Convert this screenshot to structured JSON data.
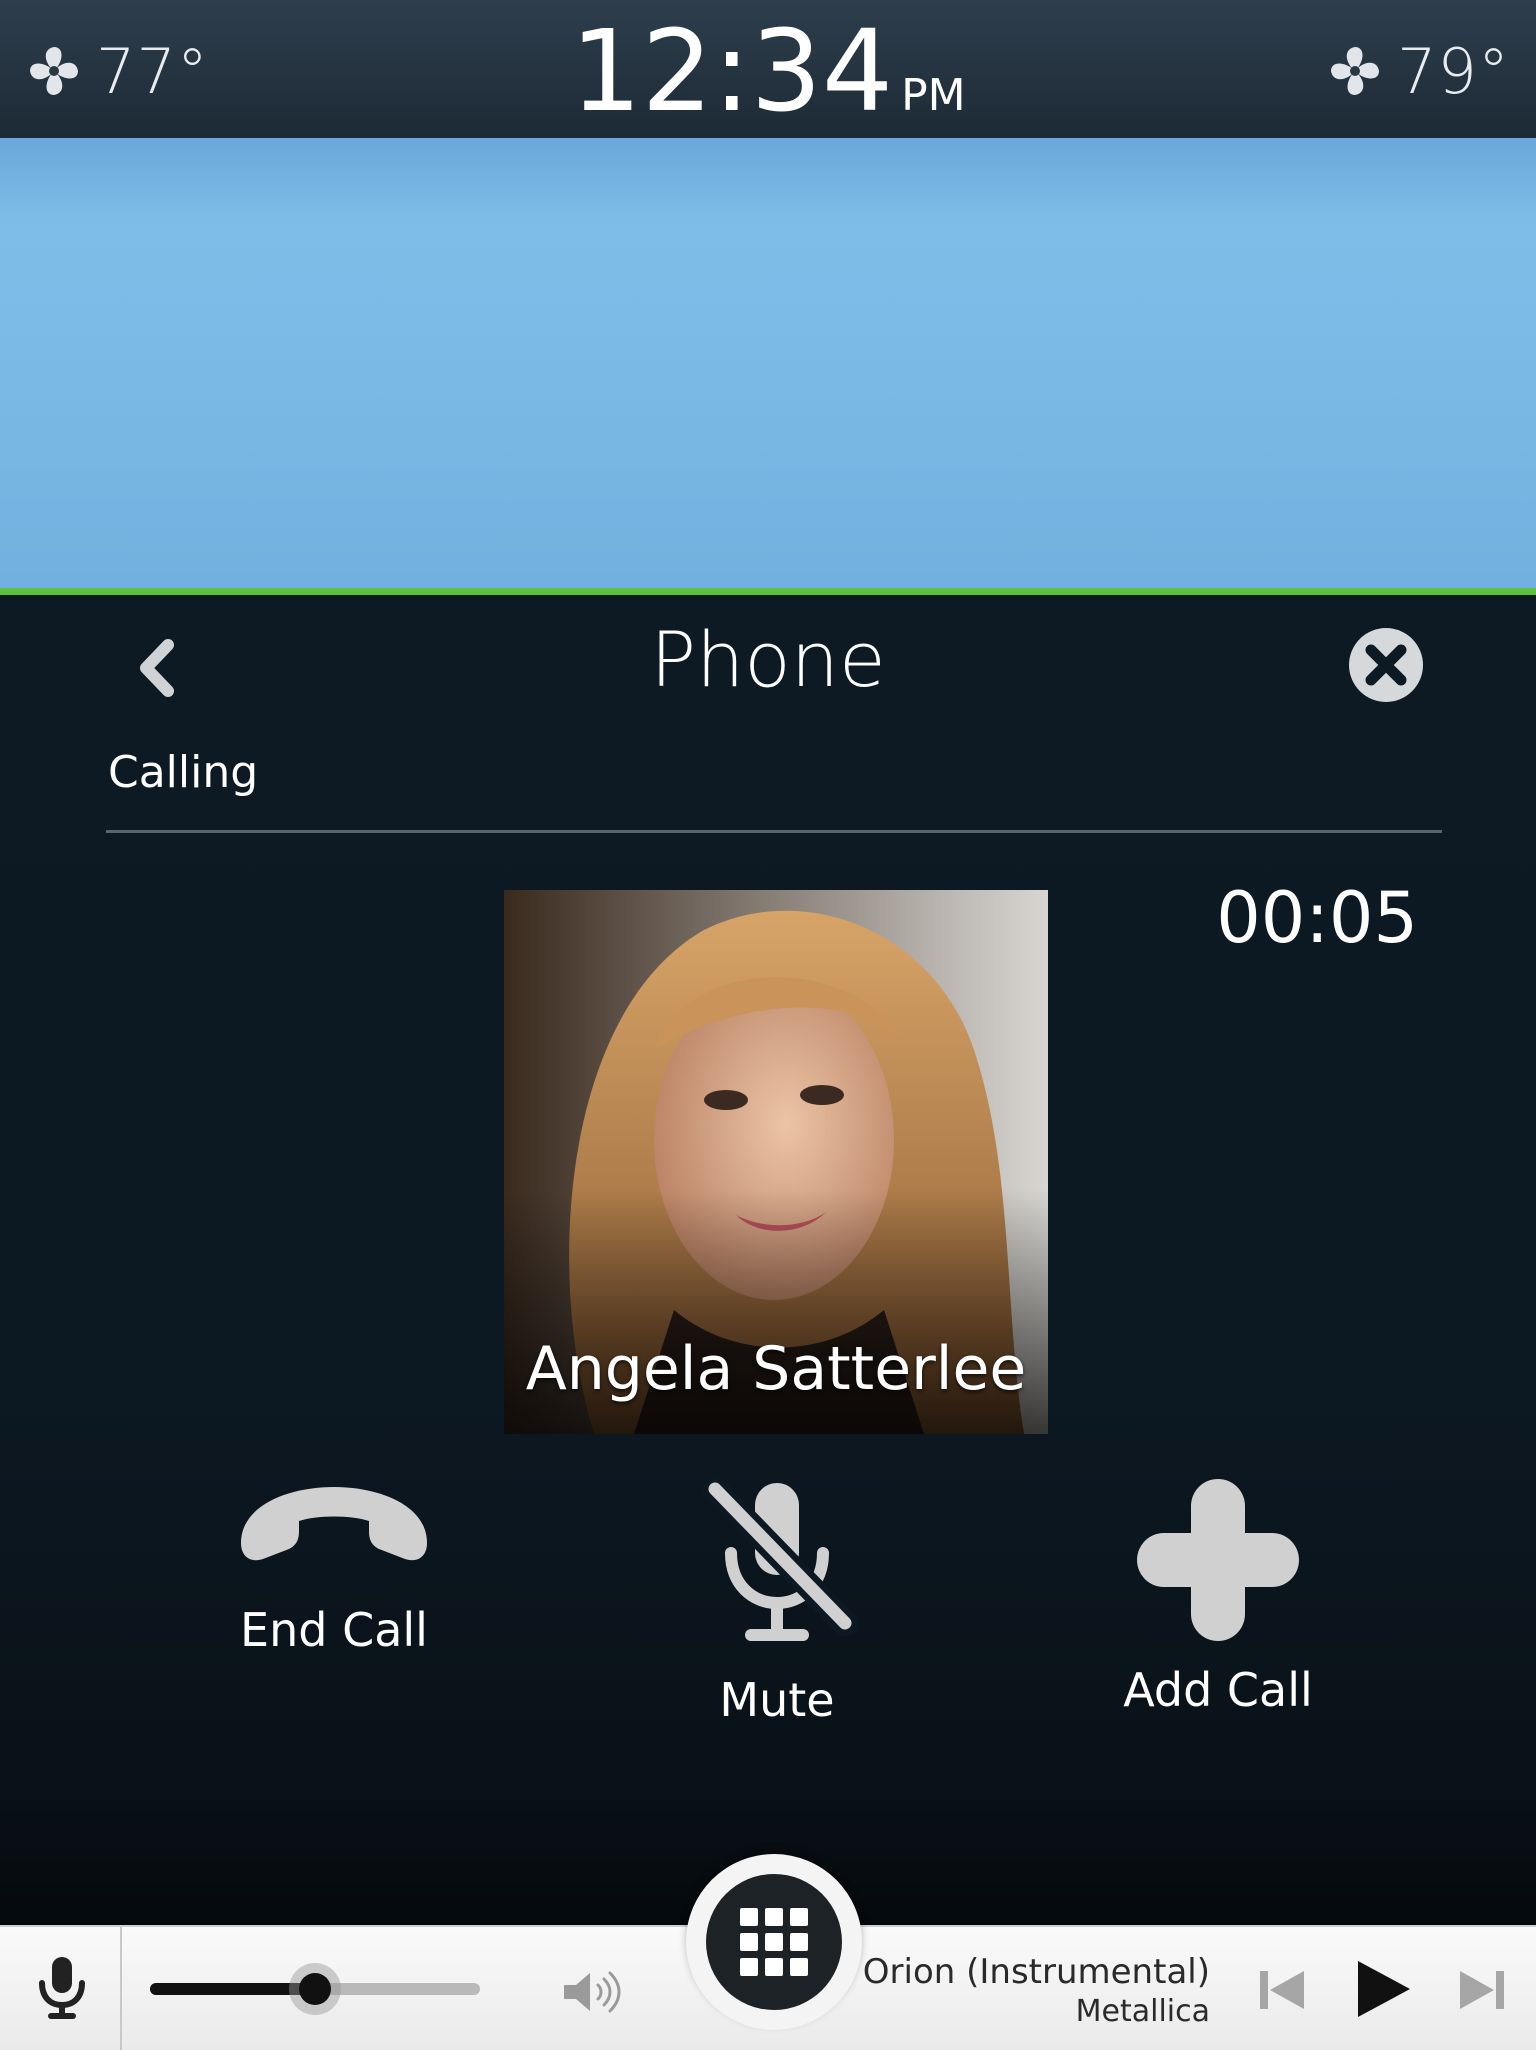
{
  "status_bar": {
    "left_temperature": "77°",
    "right_temperature": "79°",
    "time": "12:34",
    "ampm": "PM",
    "left_fan_icon": "fan-icon",
    "right_fan_icon": "fan-icon"
  },
  "phone": {
    "title": "Phone",
    "call_status": "Calling",
    "call_timer": "00:05",
    "contact_name": "Angela Satterlee",
    "back_icon": "chevron-left-icon",
    "close_icon": "close-circle-icon",
    "actions": [
      {
        "label": "End Call",
        "icon": "end-call-icon"
      },
      {
        "label": "Mute",
        "icon": "microphone-muted-icon"
      },
      {
        "label": "Add Call",
        "icon": "plus-icon"
      }
    ]
  },
  "media_bar": {
    "track_title": "Orion (Instrumental)",
    "artist": "Metallica",
    "volume_fraction": 0.5,
    "icons": [
      "microphone-icon",
      "speaker-icon",
      "apps-grid-icon",
      "skip-previous-icon",
      "play-icon",
      "skip-next-icon"
    ]
  },
  "colors": {
    "accent_green": "#5cc43c",
    "panel_background": "#0d1a24",
    "icon_gray": "#d0d0d0"
  }
}
